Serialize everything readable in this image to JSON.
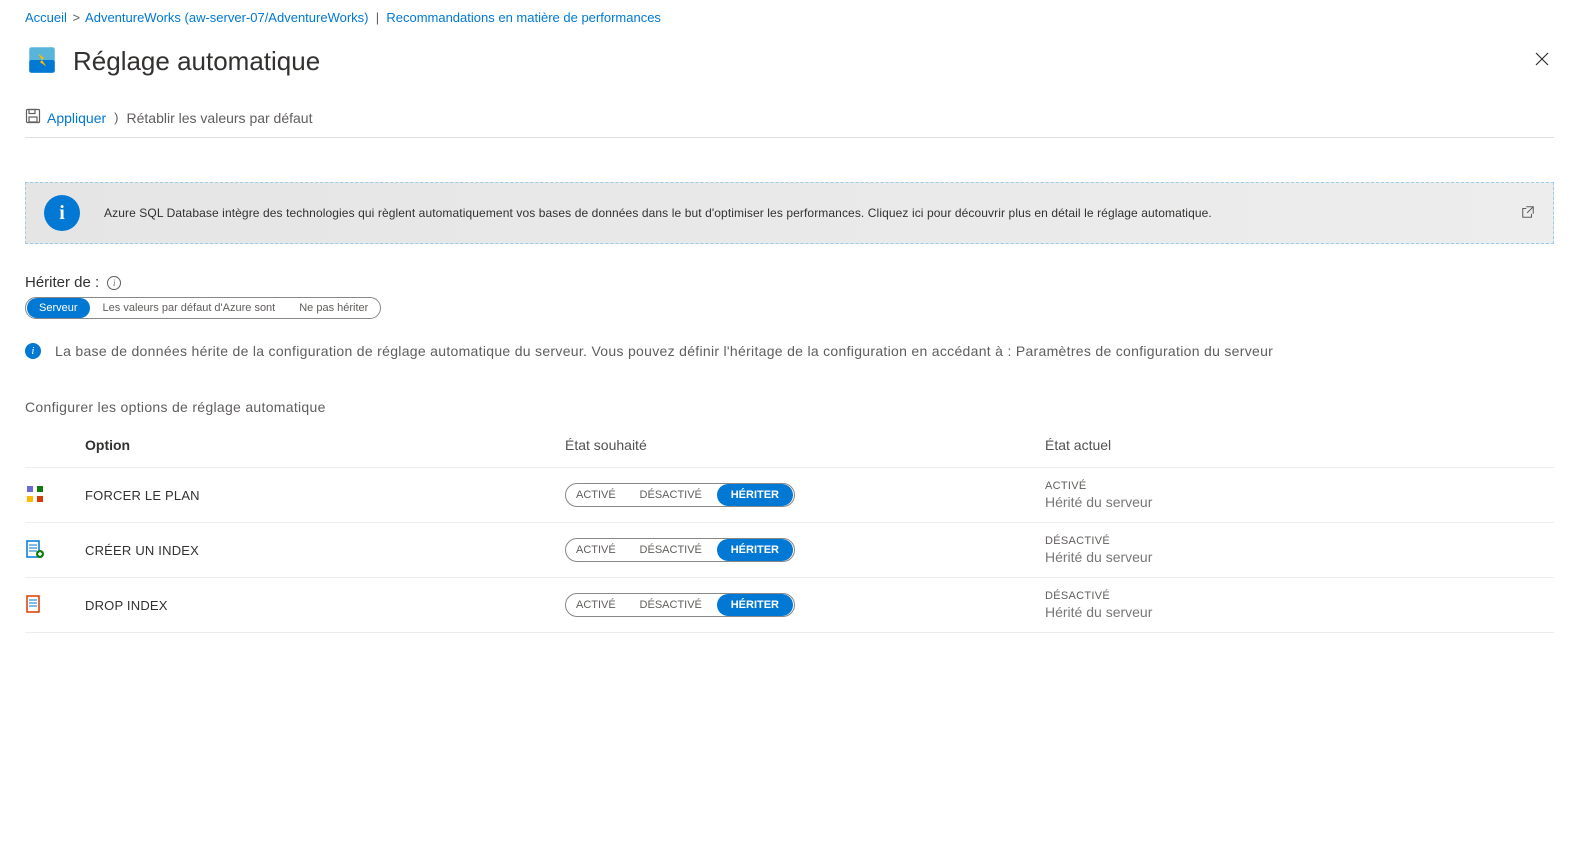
{
  "breadcrumb": {
    "home": "Accueil",
    "resource": "AdventureWorks (aw-server-07/AdventureWorks)",
    "sep_pipe": "|",
    "section": "Recommandations en matière de performances"
  },
  "page": {
    "title": "Réglage automatique"
  },
  "toolbar": {
    "apply": "Appliquer",
    "reset": "Rétablir les valeurs par défaut"
  },
  "banner": {
    "text": "Azure SQL Database intègre des technologies qui règlent automatiquement vos bases de données dans le but d'optimiser les performances. Cliquez ici pour découvrir plus en détail le réglage automatique."
  },
  "inherit": {
    "label": "Hériter de :",
    "options": [
      "Serveur",
      "Les valeurs par défaut d'Azure sont",
      "Ne pas hériter"
    ],
    "desc": "La base de données hérite de la configuration de réglage automatique du serveur. Vous pouvez définir l'héritage de la configuration en accédant à : Paramètres de configuration du serveur"
  },
  "configure_label": "Configurer les options de réglage automatique",
  "columns": {
    "option": "Option",
    "desired": "État souhaité",
    "current": "État actuel"
  },
  "toggle_labels": {
    "on": "ACTIVÉ",
    "off": "DÉSACTIVÉ",
    "inherit": "HÉRITER"
  },
  "rows": [
    {
      "name": "FORCER LE PLAN",
      "current": "ACTIVÉ",
      "sub": "Hérité du serveur"
    },
    {
      "name": "CRÉER UN INDEX",
      "current": "DÉSACTIVÉ",
      "sub": "Hérité du serveur"
    },
    {
      "name": "DROP INDEX",
      "current": "DÉSACTIVÉ",
      "sub": "Hérité du serveur"
    }
  ]
}
